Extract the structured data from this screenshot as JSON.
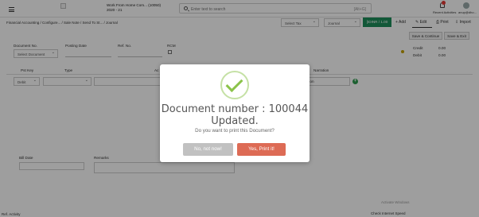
{
  "header": {
    "company": "Work From Home Com... (10050)",
    "year": "2020 - 21",
    "search_placeholder": "Enter text to search",
    "search_shortcut": "[Alt+G]",
    "recent_label": "Recent Activities",
    "user_label": "anup@dho..."
  },
  "breadcrumb": "Financial Accounting  /  Configure...  /  Sale Note  /  Send To St...  /  Journal",
  "toolbar": {
    "tax_select": "Select Tax",
    "journal_select": "Journal",
    "rate_button": "[IDINR / 1.00",
    "add": "+ Add",
    "edit": "Edit",
    "print": "Print",
    "import": "Import",
    "save_continue": "Save & Continue",
    "save_exit": "Save & Exit"
  },
  "form": {
    "document_no_label": "Document No.",
    "document_select": "Select Document",
    "posting_date_label": "Posting Date",
    "ref_no_label": "Ref. No.",
    "rcm_label": "RCM",
    "credit_label": "Credit",
    "credit_value": "0.00",
    "debit_label": "Debit",
    "debit_value": "0.00"
  },
  "grid": {
    "headers": [
      "Pst Key",
      "Type",
      "Ac",
      "Narration"
    ],
    "row_pst": "Debit",
    "row_tion": "tion"
  },
  "bottom": {
    "bill_date_label": "Bill Date",
    "remarks_label": "Remarks",
    "footer_left": "Ref. Activity",
    "footer_right": "Check Internet Speed",
    "watermark": "Activate Windows"
  },
  "modal": {
    "title": "Document number : 100044 Updated.",
    "text": "Do you want to print this Document?",
    "no_label": "No, not now!",
    "yes_label": "Yes, Print it!"
  }
}
